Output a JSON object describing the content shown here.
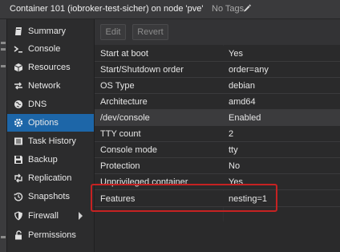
{
  "header": {
    "title": "Container 101 (iobroker-test-sicher) on node 'pve'",
    "tags": "No Tags"
  },
  "toolbar": {
    "edit": "Edit",
    "revert": "Revert"
  },
  "sidebar": {
    "items": [
      {
        "label": "Summary",
        "icon": "book-icon"
      },
      {
        "label": "Console",
        "icon": "terminal-icon"
      },
      {
        "label": "Resources",
        "icon": "cube-icon"
      },
      {
        "label": "Network",
        "icon": "network-icon"
      },
      {
        "label": "DNS",
        "icon": "globe-icon"
      },
      {
        "label": "Options",
        "icon": "gear-icon",
        "selected": true
      },
      {
        "label": "Task History",
        "icon": "list-icon"
      },
      {
        "label": "Backup",
        "icon": "floppy-icon"
      },
      {
        "label": "Replication",
        "icon": "retweet-icon"
      },
      {
        "label": "Snapshots",
        "icon": "history-icon"
      },
      {
        "label": "Firewall",
        "icon": "shield-icon"
      },
      {
        "label": "Permissions",
        "icon": "unlock-icon"
      }
    ]
  },
  "options": [
    {
      "key": "Start at boot",
      "value": "Yes"
    },
    {
      "key": "Start/Shutdown order",
      "value": "order=any"
    },
    {
      "key": "OS Type",
      "value": "debian"
    },
    {
      "key": "Architecture",
      "value": "amd64"
    },
    {
      "key": "/dev/console",
      "value": "Enabled"
    },
    {
      "key": "TTY count",
      "value": "2"
    },
    {
      "key": "Console mode",
      "value": "tty"
    },
    {
      "key": "Protection",
      "value": "No"
    },
    {
      "key": "Unprivileged container",
      "value": "Yes"
    },
    {
      "key": "Features",
      "value": "nesting=1"
    }
  ],
  "colors": {
    "accent": "#1d66a8",
    "annotation": "#c62222"
  }
}
